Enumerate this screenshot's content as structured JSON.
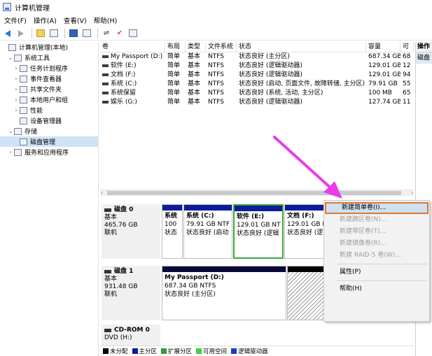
{
  "window": {
    "title": "计算机管理"
  },
  "menu": [
    "文件(F)",
    "操作(A)",
    "查看(V)",
    "帮助(H)"
  ],
  "toolbar": {
    "icons": [
      "back-icon",
      "forward-icon",
      "up-folder-icon",
      "console-tree-icon",
      "help-icon",
      "properties-icon",
      "connect-icon",
      "check-icon",
      "view-icon"
    ]
  },
  "tree": [
    {
      "label": "计算机管理(本地)",
      "icon": "computer-icon",
      "indent": 0,
      "chev": ""
    },
    {
      "label": "系统工具",
      "icon": "tools-icon",
      "indent": 1,
      "chev": "⌄"
    },
    {
      "label": "任务计划程序",
      "icon": "clock-icon",
      "indent": 2,
      "chev": "›"
    },
    {
      "label": "事件查看器",
      "icon": "event-icon",
      "indent": 2,
      "chev": "›"
    },
    {
      "label": "共享文件夹",
      "icon": "share-icon",
      "indent": 2,
      "chev": "›"
    },
    {
      "label": "本地用户和组",
      "icon": "users-icon",
      "indent": 2,
      "chev": "›"
    },
    {
      "label": "性能",
      "icon": "performance-icon",
      "indent": 2,
      "chev": "›"
    },
    {
      "label": "设备管理器",
      "icon": "device-icon",
      "indent": 2,
      "chev": ""
    },
    {
      "label": "存储",
      "icon": "storage-icon",
      "indent": 1,
      "chev": "⌄"
    },
    {
      "label": "磁盘管理",
      "icon": "disk-icon",
      "indent": 2,
      "chev": "",
      "selected": true
    },
    {
      "label": "服务和应用程序",
      "icon": "services-icon",
      "indent": 1,
      "chev": "›"
    }
  ],
  "volumes": {
    "headers": [
      "卷",
      "布局",
      "类型",
      "文件系统",
      "状态",
      "容量",
      "可"
    ],
    "rows": [
      [
        "My Passport (D:)",
        "简单",
        "基本",
        "NTFS",
        "状态良好 (主分区)",
        "687.34 GB",
        "68"
      ],
      [
        "软件 (E:)",
        "简单",
        "基本",
        "NTFS",
        "状态良好 (逻辑驱动器)",
        "129.01 GB",
        "12"
      ],
      [
        "文档 (F:)",
        "简单",
        "基本",
        "NTFS",
        "状态良好 (逻辑驱动器)",
        "129.01 GB",
        "94"
      ],
      [
        "系统 (C:)",
        "简单",
        "基本",
        "NTFS",
        "状态良好 (启动, 页面文件, 故障转储, 主分区)",
        "79.91 GB",
        "55"
      ],
      [
        "系统保留",
        "简单",
        "基本",
        "NTFS",
        "状态良好 (系统, 活动, 主分区)",
        "100 MB",
        "65"
      ],
      [
        "娱乐 (G:)",
        "简单",
        "基本",
        "NTFS",
        "状态良好 (逻辑驱动器)",
        "127.74 GB",
        "11"
      ]
    ]
  },
  "actions": {
    "header": "操作",
    "item": "磁盘"
  },
  "disks": [
    {
      "name": "磁盘 0",
      "type": "基本",
      "size": "465.76 GB",
      "status": "联机",
      "partitions": [
        {
          "line1": "系统",
          "line2": "100",
          "line3": "状态"
        },
        {
          "line1": "系统  (C:)",
          "line2": "79.91 GB NTF",
          "line3": "状态良好 (启动"
        },
        {
          "line1": "软件  (E:)",
          "line2": "129.01 GB NT",
          "line3": "状态良好 (逻辑"
        },
        {
          "line1": "文档  (F:)",
          "line2": "129.01 GB N",
          "line3": "状态良好 (逻"
        }
      ]
    },
    {
      "name": "磁盘 1",
      "type": "基本",
      "size": "931.48 GB",
      "status": "联机",
      "partitions": [
        {
          "line1": "My Passport  (D:)",
          "line2": "687.34 GB NTFS",
          "line3": "状态良好 (主分区)"
        }
      ]
    },
    {
      "name": "CD-ROM 0",
      "type": "DVD (H:)"
    }
  ],
  "legend": [
    {
      "label": "未分配",
      "color": "#000000"
    },
    {
      "label": "主分区",
      "color": "#0b1c9c"
    },
    {
      "label": "扩展分区",
      "color": "#2e9e3a"
    },
    {
      "label": "可用空间",
      "color": "#43d13f"
    },
    {
      "label": "逻辑驱动器",
      "color": "#1a3cc8"
    }
  ],
  "context_menu": [
    {
      "label": "新建简单卷(I)...",
      "enabled": true,
      "highlighted": true
    },
    {
      "label": "新建跨区卷(N)...",
      "enabled": false
    },
    {
      "label": "新建带区卷(T)...",
      "enabled": false
    },
    {
      "label": "新建镜像卷(R)...",
      "enabled": false
    },
    {
      "label": "新建 RAID-5 卷(W)...",
      "enabled": false
    },
    {
      "separator": true
    },
    {
      "label": "属性(P)",
      "enabled": true
    },
    {
      "separator": true
    },
    {
      "label": "帮助(H)",
      "enabled": true
    }
  ],
  "colors": {
    "annotation_arrow": "#e83ee8",
    "highlight_border": "#e0772b",
    "selection_green": "#3aa83a"
  }
}
